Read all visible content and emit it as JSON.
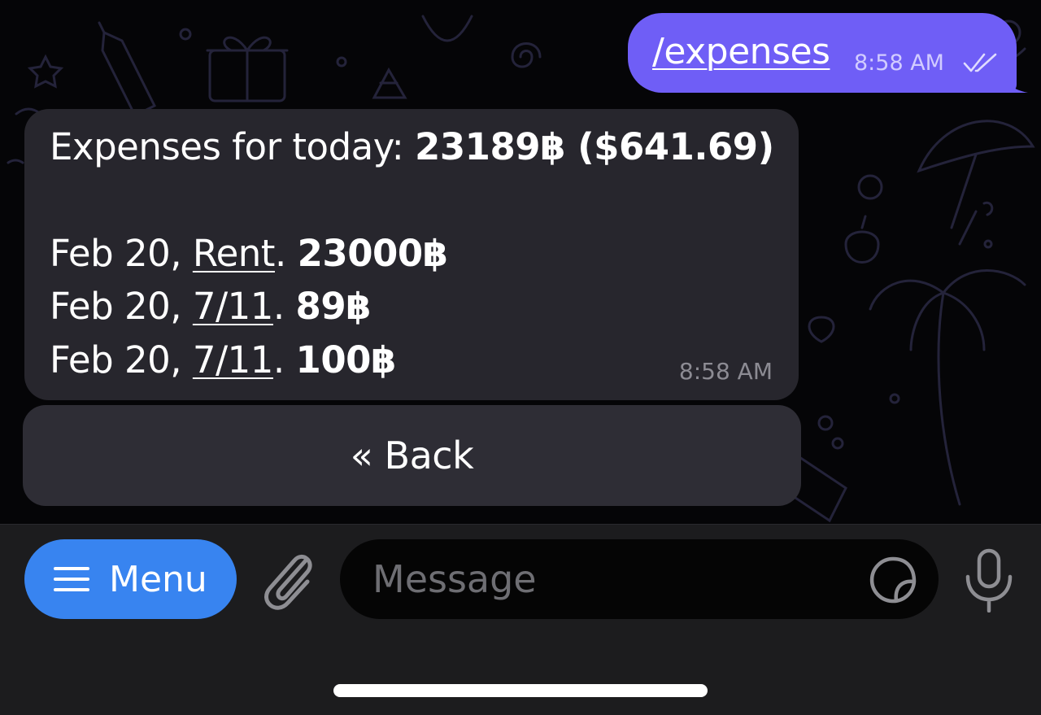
{
  "outgoing": {
    "text": "/expenses",
    "time": "8:58 AM",
    "status_icon": "double-check-icon"
  },
  "incoming": {
    "header_label": "Expenses for today:",
    "header_total": "23189฿ ($641.69)",
    "entries": [
      {
        "date": "Feb 20,",
        "category": "Rent",
        "amount": "23000฿"
      },
      {
        "date": "Feb 20,",
        "category": "7/11",
        "amount": "89฿"
      },
      {
        "date": "Feb 20,",
        "category": "7/11",
        "amount": "100฿"
      }
    ],
    "time": "8:58 AM"
  },
  "inline_keyboard": {
    "back_label": "« Back"
  },
  "composer": {
    "menu_label": "Menu",
    "message_placeholder": "Message",
    "icons": [
      "menu-lines-icon",
      "paperclip-icon",
      "sticker-icon",
      "microphone-icon"
    ]
  },
  "colors": {
    "outgoing_bubble": "#6f5ef6",
    "incoming_bubble": "#27262d",
    "menu_button": "#3884f0",
    "bottom_bar": "#1c1c1e"
  }
}
